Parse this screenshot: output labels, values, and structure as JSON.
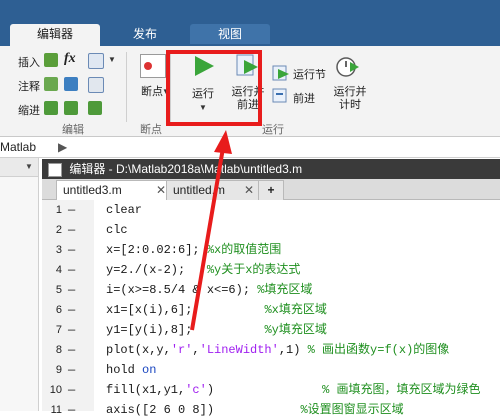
{
  "tabs": {
    "editor": "编辑器",
    "publish": "发布",
    "view": "视图"
  },
  "ribbon": {
    "insert": "插入",
    "comment": "注释",
    "indent": "缩进",
    "fx": "fx",
    "edit_section": "编辑",
    "breakpoints_btn": "断点",
    "breakpoints_section": "断点",
    "run": "运行",
    "run_advance_1": "运行并",
    "run_advance_2": "前进",
    "run_section": "运行节",
    "advance": "前进",
    "run_time_1": "运行并",
    "run_time_2": "计时",
    "run_group": "运行"
  },
  "path": {
    "text": "Matlab"
  },
  "editor": {
    "title": "编辑器 - D:\\Matlab2018a\\Matlab\\untitled3.m",
    "tab1": "untitled3.m",
    "tab2": "untitled.m",
    "add": "+"
  },
  "lines": [
    {
      "n": "1",
      "code": "clear"
    },
    {
      "n": "2",
      "code": "clc"
    },
    {
      "n": "3",
      "code": "x=[2:0.02:6];",
      "comment": "%x的取值范围"
    },
    {
      "n": "4",
      "code": "y=2./(x-2);",
      "comment": "%y关于x的表达式"
    },
    {
      "n": "5",
      "code": "i=(x>=8.5/4 & x<=6);",
      "comment": "%填充区域"
    },
    {
      "n": "6",
      "code": "x1=[x(i),6];",
      "comment": "%x填充区域"
    },
    {
      "n": "7",
      "code": "y1=[y(i),8];",
      "comment": "%y填充区域"
    },
    {
      "n": "8",
      "code_a": "plot(x,y,",
      "str1": "'r'",
      "code_b": ",",
      "str2": "'LineWidth'",
      "code_c": ",1)",
      "comment": "% 画出函数y=f(x)的图像"
    },
    {
      "n": "9",
      "code": "hold ",
      "kw": "on"
    },
    {
      "n": "10",
      "code_a": "fill(x1,y1,",
      "str1": "'c'",
      "code_c": ")",
      "comment": "% 画填充图，填充区域为绿色"
    },
    {
      "n": "11",
      "code": "axis([2 6 0 8])",
      "comment": "%设置图窗显示区域"
    }
  ],
  "colors": {
    "highlight": "#e81c1c",
    "tabbar": "#2e5f93",
    "comment": "#1f8f1f",
    "string": "#a020f0",
    "keyword": "#1a46c0"
  }
}
